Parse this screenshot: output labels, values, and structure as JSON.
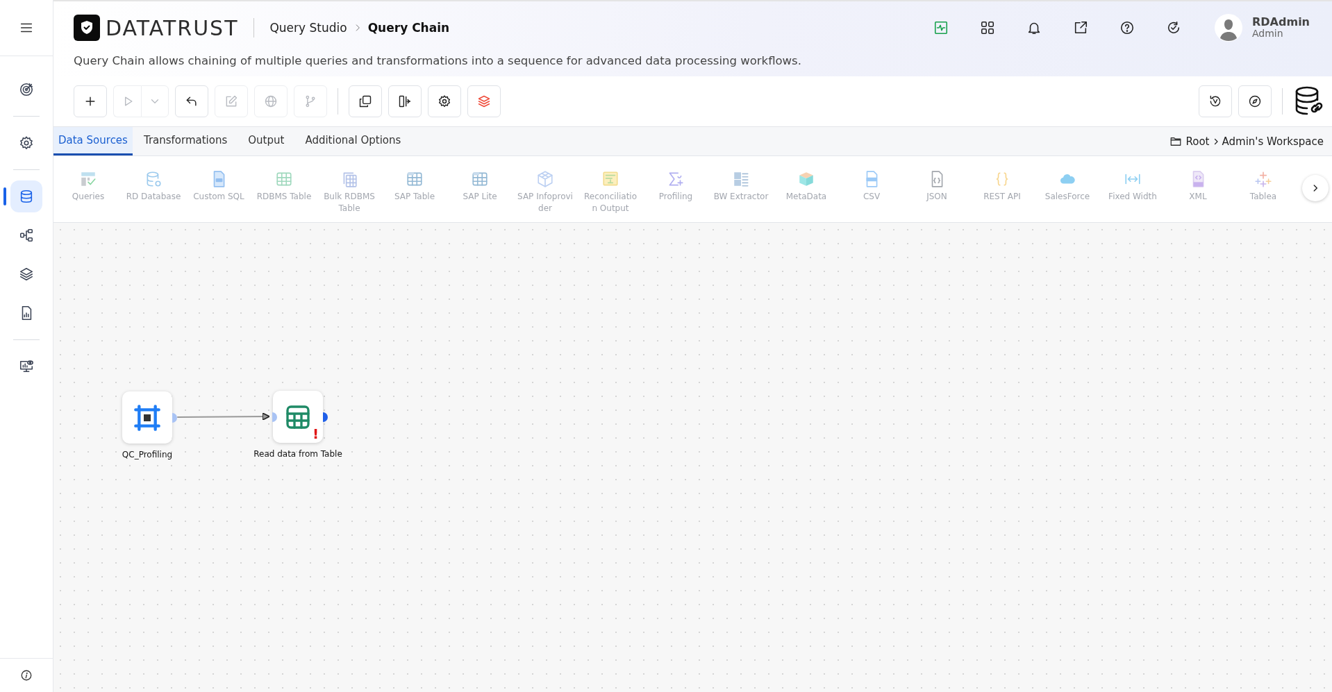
{
  "sidebar": {
    "groups": [
      [
        {
          "kind": "target",
          "selected": false
        }
      ],
      [
        {
          "kind": "gear",
          "selected": false
        }
      ],
      [
        {
          "kind": "database",
          "selected": true
        },
        {
          "kind": "nodes",
          "selected": false
        },
        {
          "kind": "layers",
          "selected": false
        },
        {
          "kind": "report",
          "selected": false
        }
      ],
      [
        {
          "kind": "monitor",
          "selected": false
        }
      ]
    ]
  },
  "header": {
    "brand": "DATATRUST",
    "breadcrumb": [
      "Query Studio",
      "Query Chain"
    ],
    "description": "Query Chain allows chaining of multiple queries and transformations into a sequence for advanced data processing workflows.",
    "icons": [
      {
        "kind": "activity"
      },
      {
        "kind": "grid"
      },
      {
        "kind": "bell"
      },
      {
        "kind": "external"
      },
      {
        "kind": "help"
      },
      {
        "kind": "refresh"
      }
    ],
    "user": {
      "name": "RDAdmin",
      "role": "Admin"
    }
  },
  "toolbar": {
    "left": [
      {
        "kind": "add",
        "disabled": false
      },
      {
        "kind": "run",
        "disabled": true
      },
      {
        "kind": "undo",
        "disabled": false
      },
      {
        "kind": "edit",
        "disabled": true
      },
      {
        "kind": "globe",
        "disabled": true
      },
      {
        "kind": "branch",
        "disabled": true
      },
      {
        "kind": "copy",
        "disabled": false
      },
      {
        "kind": "split",
        "disabled": false
      },
      {
        "kind": "gear",
        "disabled": false
      },
      {
        "kind": "stack",
        "disabled": false
      }
    ],
    "right": [
      {
        "kind": "history",
        "disabled": false
      },
      {
        "kind": "compass",
        "disabled": false
      }
    ]
  },
  "tabs": [
    {
      "label": "Data Sources",
      "selected": true
    },
    {
      "label": "Transformations",
      "selected": false
    },
    {
      "label": "Output",
      "selected": false
    },
    {
      "label": "Additional Options",
      "selected": false
    }
  ],
  "location": [
    "Root",
    "Admin's Workspace"
  ],
  "palette": [
    {
      "label": "Queries",
      "kind": "queries"
    },
    {
      "label": "RD Database",
      "kind": "database"
    },
    {
      "label": "Custom SQL",
      "kind": "sql"
    },
    {
      "label": "RDBMS Table",
      "kind": "table"
    },
    {
      "label": "Bulk RDBMS Table",
      "kind": "bulk"
    },
    {
      "label": "SAP Table",
      "kind": "sap"
    },
    {
      "label": "SAP Lite",
      "kind": "sap"
    },
    {
      "label": "SAP Infoprovider",
      "kind": "cube"
    },
    {
      "label": "Reconciliation Output",
      "kind": "recon"
    },
    {
      "label": "Profiling",
      "kind": "sigma"
    },
    {
      "label": "BW Extractor",
      "kind": "bw"
    },
    {
      "label": "MetaData",
      "kind": "metadata"
    },
    {
      "label": "CSV",
      "kind": "csv"
    },
    {
      "label": "JSON",
      "kind": "json"
    },
    {
      "label": "REST API",
      "kind": "braces"
    },
    {
      "label": "SalesForce",
      "kind": "cloud"
    },
    {
      "label": "Fixed Width",
      "kind": "width"
    },
    {
      "label": "XML",
      "kind": "xml"
    },
    {
      "label": "Tablea",
      "kind": "tableau"
    }
  ],
  "nodes": [
    {
      "label": "QC_Profiling",
      "kind": "profiling",
      "linked": true
    },
    {
      "label": "Read data from Table",
      "kind": "table",
      "alert": "!",
      "linked": false
    }
  ]
}
